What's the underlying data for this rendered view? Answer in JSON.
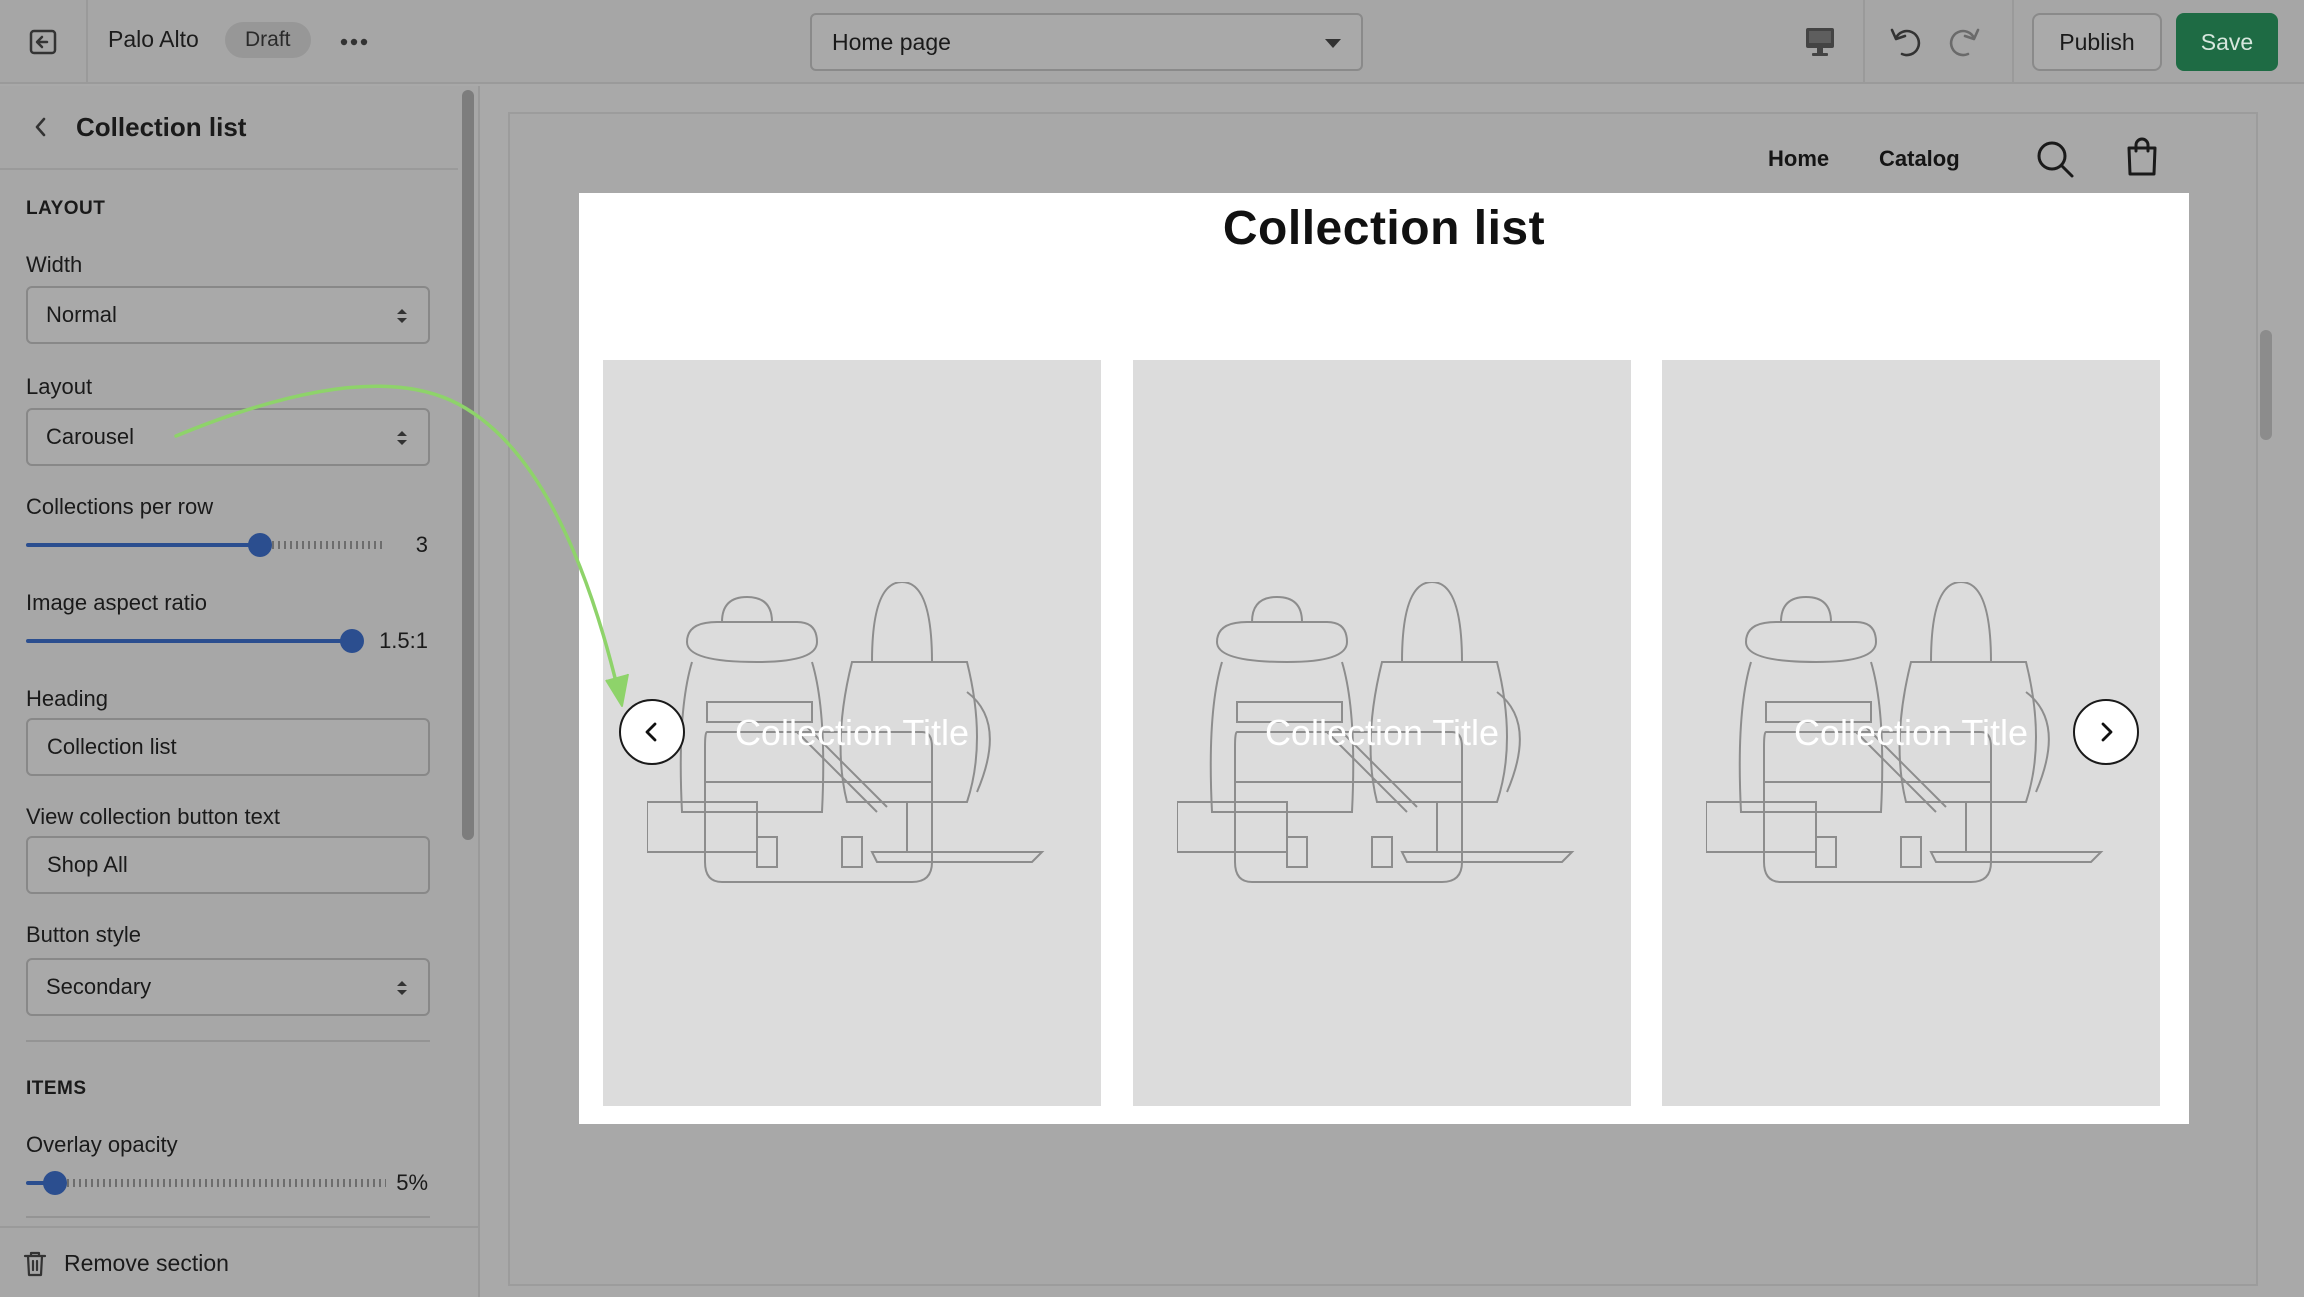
{
  "topbar": {
    "store_name": "Palo Alto",
    "status_badge": "Draft",
    "page_select_value": "Home page",
    "publish_label": "Publish",
    "save_label": "Save"
  },
  "sidebar": {
    "title": "Collection list",
    "layout_section_label": "LAYOUT",
    "width_label": "Width",
    "width_value": "Normal",
    "layout_label": "Layout",
    "layout_value": "Carousel",
    "collections_per_row_label": "Collections per row",
    "collections_per_row_value": "3",
    "collections_per_row_fraction": 0.66,
    "image_aspect_ratio_label": "Image aspect ratio",
    "image_aspect_ratio_value": "1.5:1",
    "image_aspect_ratio_fraction": 1.0,
    "heading_label": "Heading",
    "heading_value": "Collection list",
    "view_button_text_label": "View collection button text",
    "view_button_text_value": "Shop All",
    "button_style_label": "Button style",
    "button_style_value": "Secondary",
    "items_section_label": "ITEMS",
    "overlay_opacity_label": "Overlay opacity",
    "overlay_opacity_value": "5%",
    "overlay_opacity_fraction": 0.05,
    "remove_section_label": "Remove section"
  },
  "preview": {
    "nav": {
      "home": "Home",
      "catalog": "Catalog"
    },
    "section_title": "Collection list",
    "cards": [
      {
        "title": "Collection Title"
      },
      {
        "title": "Collection Title"
      },
      {
        "title": "Collection Title"
      }
    ]
  },
  "colors": {
    "accent": "#2b4e8f",
    "save_button": "#1e6b44",
    "annotation_arrow": "#8ed36a"
  }
}
